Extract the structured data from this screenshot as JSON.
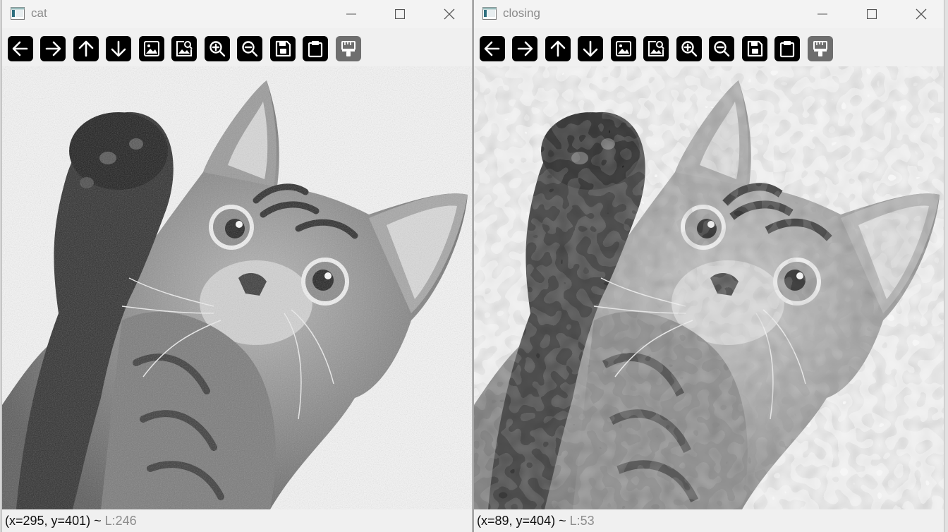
{
  "windows": [
    {
      "title": "cat",
      "status": {
        "coords": "(x=295, y=401)",
        "sep": " ~ ",
        "level": "L:246"
      }
    },
    {
      "title": "closing",
      "status": {
        "coords": "(x=89, y=404)",
        "sep": " ~ ",
        "level": "L:53"
      }
    }
  ],
  "toolbar": {
    "buttons": [
      {
        "icon": "arrow-left-icon",
        "tooltip": "Panning left"
      },
      {
        "icon": "arrow-right-icon",
        "tooltip": "Panning right"
      },
      {
        "icon": "arrow-up-icon",
        "tooltip": "Panning up"
      },
      {
        "icon": "arrow-down-icon",
        "tooltip": "Panning down"
      },
      {
        "icon": "image-icon",
        "tooltip": "Zoom x1"
      },
      {
        "icon": "zoom-image-icon",
        "tooltip": "Zoom x30"
      },
      {
        "icon": "zoom-in-icon",
        "tooltip": "Zoom in"
      },
      {
        "icon": "zoom-out-icon",
        "tooltip": "Zoom out"
      },
      {
        "icon": "save-icon",
        "tooltip": "Save current image"
      },
      {
        "icon": "clipboard-icon",
        "tooltip": "Copy image to clipboard"
      },
      {
        "icon": "properties-brush-icon",
        "tooltip": "Show properties window"
      }
    ]
  },
  "colors": {
    "toolbar_button": "#000000",
    "toolbar_button_disabled": "#6e6e6e",
    "image_bg": "#f6f6f6",
    "status_level": "#8c8c8c"
  }
}
